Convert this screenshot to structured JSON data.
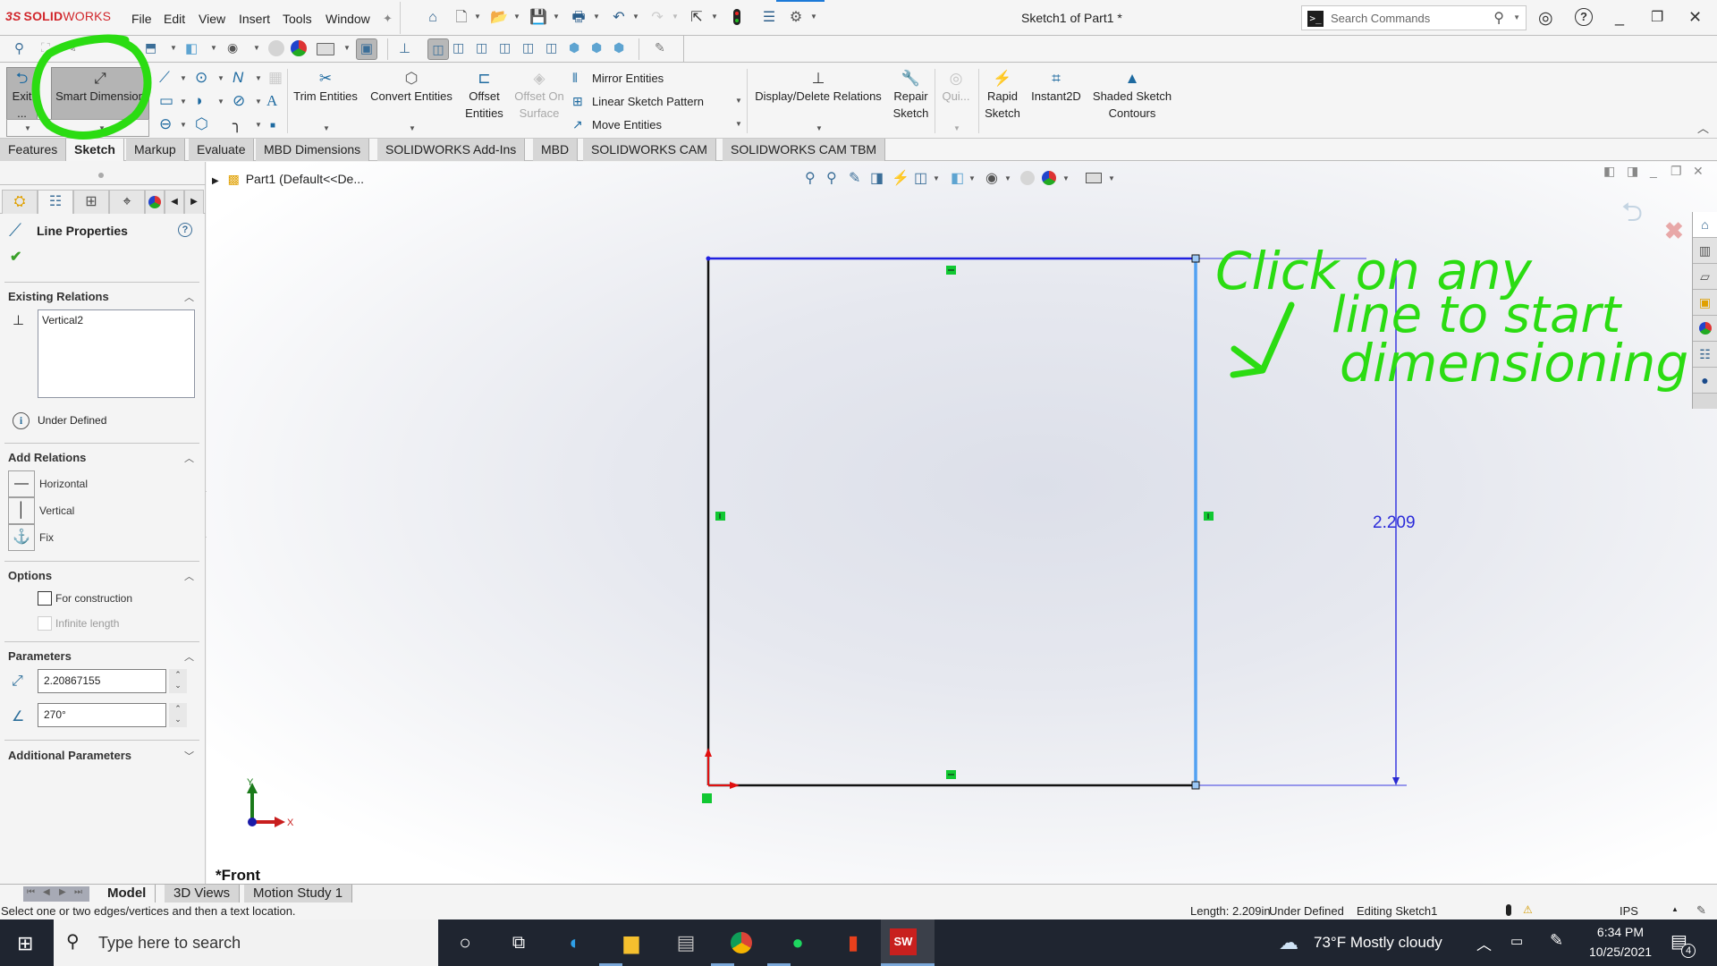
{
  "app": {
    "brand": "SOLIDWORKS",
    "brand_ds": "3S",
    "brand_bold": "SOLID",
    "brand_thin": "WORKS",
    "document_title": "Sketch1 of Part1 *"
  },
  "menu": [
    "File",
    "Edit",
    "View",
    "Insert",
    "Tools",
    "Window"
  ],
  "search": {
    "placeholder": "Search Commands"
  },
  "title_icons": [
    "home-icon",
    "new-document-icon",
    "open-icon",
    "save-icon",
    "print-icon",
    "undo-icon",
    "redo-icon",
    "select-icon",
    "rebuild-icon",
    "file-properties-icon",
    "options-icon"
  ],
  "command_manager": {
    "exit_sketch": "Exit ...",
    "smart_dimension": "Smart Dimension",
    "trim_entities": "Trim Entities",
    "convert_entities": "Convert Entities",
    "offset_entities": [
      "Offset",
      "Entities"
    ],
    "offset_on_surface": [
      "Offset On",
      "Surface"
    ],
    "mirror_entities": "Mirror Entities",
    "linear_sketch_pattern": "Linear Sketch Pattern",
    "move_entities": "Move Entities",
    "display_delete_relations": "Display/Delete Relations",
    "repair_sketch": [
      "Repair",
      "Sketch"
    ],
    "quick_snaps": "Qui...",
    "rapid_sketch": [
      "Rapid",
      "Sketch"
    ],
    "instant2d": "Instant2D",
    "shaded_sketch_contours": [
      "Shaded Sketch",
      "Contours"
    ]
  },
  "tabs": [
    {
      "label": "Features",
      "active": false
    },
    {
      "label": "Sketch",
      "active": true
    },
    {
      "label": "Markup",
      "active": false
    },
    {
      "label": "Evaluate",
      "active": false
    },
    {
      "label": "MBD Dimensions",
      "active": false
    },
    {
      "label": "SOLIDWORKS Add-Ins",
      "active": false
    },
    {
      "label": "MBD",
      "active": false
    },
    {
      "label": "SOLIDWORKS CAM",
      "active": false
    },
    {
      "label": "SOLIDWORKS CAM TBM",
      "active": false
    }
  ],
  "property_manager": {
    "title": "Line Properties",
    "existing_relations": {
      "header": "Existing Relations",
      "items": [
        "Vertical2"
      ],
      "status": "Under Defined"
    },
    "add_relations": {
      "header": "Add Relations",
      "items": [
        "Horizontal",
        "Vertical",
        "Fix"
      ]
    },
    "options": {
      "header": "Options",
      "for_construction": {
        "label": "For construction",
        "checked": false
      },
      "infinite_length": {
        "label": "Infinite length",
        "checked": false,
        "disabled": true
      }
    },
    "parameters": {
      "header": "Parameters",
      "length": "2.20867155",
      "angle": "270°"
    },
    "additional_parameters": {
      "header": "Additional Parameters"
    }
  },
  "viewport": {
    "tree_root": "Part1  (Default<<De...",
    "view_label": "*Front",
    "dimension_value": "2.209",
    "annotation": [
      "Click on any",
      "line to start",
      "dimensioning"
    ],
    "triad": {
      "x": "X",
      "y": "Y"
    }
  },
  "bottom_tabs": [
    {
      "label": "Model",
      "active": true
    },
    {
      "label": "3D Views",
      "active": false
    },
    {
      "label": "Motion Study 1",
      "active": false
    }
  ],
  "status_bar": {
    "hint": "Select one or two edges/vertices and then a text location.",
    "length": "Length: 2.209in",
    "definition": "Under Defined",
    "mode": "Editing Sketch1",
    "units": "IPS"
  },
  "taskbar": {
    "search_placeholder": "Type here to search",
    "weather": "73°F  Mostly cloudy",
    "time": "6:34 PM",
    "date": "10/25/2021",
    "notifications": "4"
  },
  "colors": {
    "accent_blue": "#1e6aa0",
    "selected_line": "#4fa0f0",
    "dimension": "#2b2bd9",
    "annotation_green": "#2bdc12",
    "relation_green": "#11c832",
    "brand_red": "#d1262b"
  }
}
